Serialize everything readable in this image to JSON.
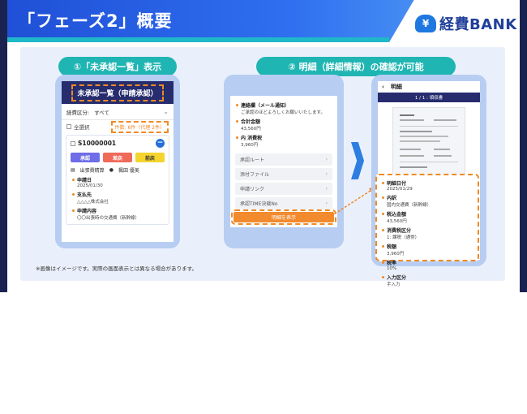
{
  "title": "「フェーズ2」概要",
  "logo": {
    "badge": "¥",
    "text": "経費BANK"
  },
  "step1": {
    "label": "①「未承認一覧」表示"
  },
  "step2": {
    "label": "② 明細（詳細情報）の確認が可能"
  },
  "screen1": {
    "nav_title": "未承認一覧（申請承認）",
    "filter_label": "経費区分:",
    "filter_value": "すべて",
    "select_all": "全選択",
    "count_text": "件数: 6件（代理 2件）",
    "card": {
      "id": "S10000001",
      "buttons": {
        "approve": "承認",
        "reject": "差戻",
        "prev": "前戻"
      },
      "category": "出張費精算",
      "person": "楓田 優美",
      "fields": [
        {
          "label": "申請日",
          "value": "2025/01/30"
        },
        {
          "label": "支払先",
          "value": "△△△△株式会社"
        },
        {
          "label": "申請内容",
          "value": "〇〇出張時の交通費（新幹線）"
        }
      ]
    }
  },
  "screen2": {
    "fields": [
      {
        "label": "連絡欄（メール通知）",
        "value": "ご承認のほどよろしくお願いいたします。"
      },
      {
        "label": "合計金額",
        "value": "43,560円"
      },
      {
        "label": "内 消費税",
        "value": "3,960円"
      }
    ],
    "links": [
      "承認ルート",
      "添付ファイル",
      "申請リンク",
      "承認TIME決裁No"
    ],
    "detail_button": "明細を表示"
  },
  "screen3": {
    "nav_title": "明細",
    "page_label": "1 / 1 : 領収書",
    "fields": [
      {
        "label": "明細日付",
        "value": "2025/01/29"
      },
      {
        "label": "内訳",
        "value": "国内交通費（新幹線）"
      },
      {
        "label": "税込金額",
        "value": "43,560円"
      },
      {
        "label": "消費税区分",
        "value": "1: 課税（通常）"
      },
      {
        "label": "税額",
        "value": "3,960円"
      },
      {
        "label": "税率",
        "value": "10%"
      },
      {
        "label": "入力区分",
        "value": "手入力"
      }
    ]
  },
  "note": "※画像はイメージです。実際の画面表示とは異なる場合があります。",
  "colors": {
    "header_blue": "#1f4fd6",
    "accent_teal": "#1fb5b2",
    "navy": "#262c6e",
    "orange": "#f08a25",
    "approve": "#6f6de8",
    "reject": "#f06a5a",
    "prev": "#f5d42e"
  }
}
